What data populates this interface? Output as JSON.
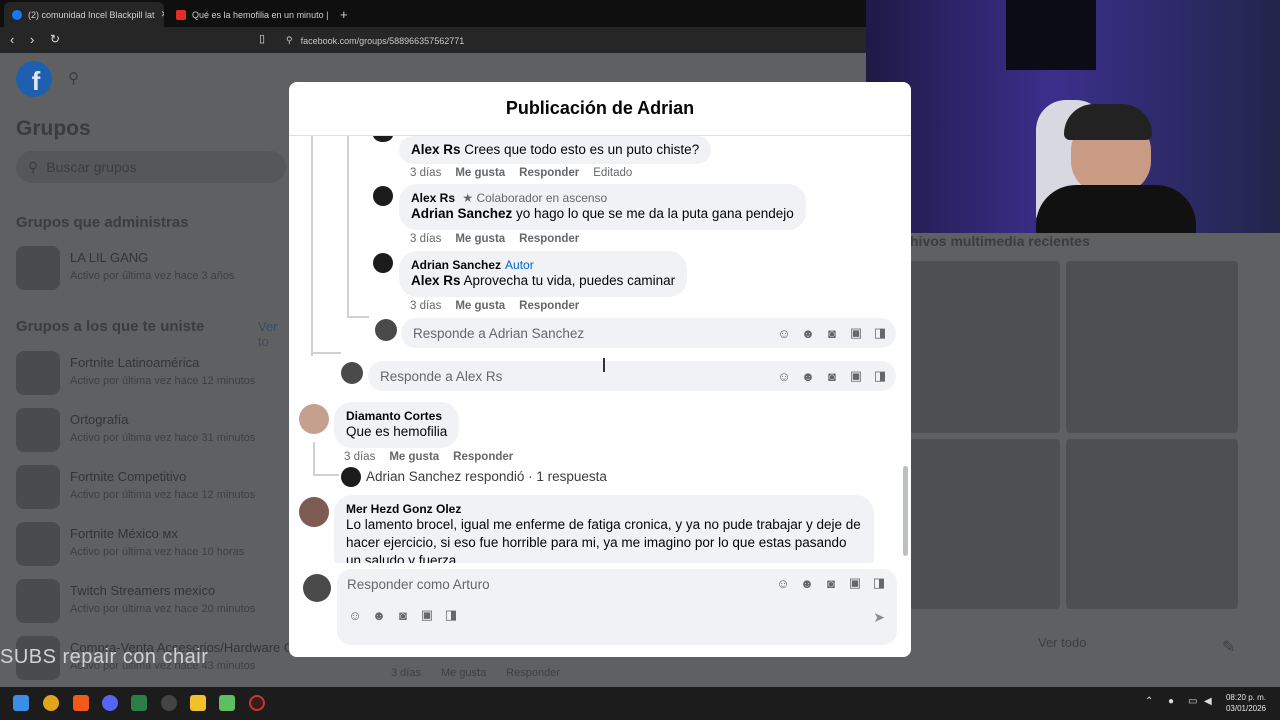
{
  "browser": {
    "tabs": [
      {
        "title": "(2) comunidad Incel Blackpill lat"
      },
      {
        "title": "Qué es la hemofilia en un minuto | Ja"
      }
    ],
    "new_tab": "+",
    "url": "facebook.com/groups/588966357562771"
  },
  "background": {
    "groups_title": "Grupos",
    "search_placeholder": "Buscar grupos",
    "admin_section": "Grupos que administras",
    "joined_section": "Grupos a los que te uniste",
    "see_all_link": "Ver to",
    "groups": [
      {
        "name": "LA LIL GANG",
        "sub": "Activo por última vez hace 3 años"
      },
      {
        "name": "Fortnite Latinoamérica",
        "sub": "Activo por última vez hace 12 minutos"
      },
      {
        "name": "Ortografía",
        "sub": "Activo por última vez hace 31 minutos"
      },
      {
        "name": "Fortnite Competitivo",
        "sub": "Activo por última vez hace 12 minutos"
      },
      {
        "name": "Fortnite México мх",
        "sub": "Activo por última vez hace 10 horas"
      },
      {
        "name": "Twitch Streamers mexico",
        "sub": "Activo por última vez hace 20 minutos"
      },
      {
        "name": "Compra-Venta Accesorios/Hardware Gamer Pc Mexico",
        "sub": "Activo por última vez hace 43 minutos"
      }
    ],
    "media_title": "hivos multimedia recientes",
    "see_all": "Ver todo"
  },
  "modal": {
    "title": "Publicación de Adrian",
    "comments": {
      "c1": {
        "name": "Alex Rs",
        "text": "Crees que todo esto es un puto chiste?",
        "time": "3 días",
        "like": "Me gusta",
        "reply": "Responder",
        "edited": "Editado"
      },
      "c2": {
        "name": "Alex Rs",
        "badge": "Colaborador en ascenso",
        "mention": "Adrian Sanchez",
        "text": "yo hago lo que se me da la puta gana pendejo",
        "time": "3 días",
        "like": "Me gusta",
        "reply": "Responder"
      },
      "c3": {
        "name": "Adrian Sanchez",
        "badge": "Autor",
        "mention": "Alex Rs",
        "text": "Aprovecha tu vida, puedes caminar",
        "time": "3 días",
        "like": "Me gusta",
        "reply": "Responder"
      },
      "c4": {
        "name": "Diamanto Cortes",
        "text": "Que es hemofilia",
        "time": "3 días",
        "like": "Me gusta",
        "reply": "Responder",
        "replies_summary": "Adrian Sanchez respondió · 1 respuesta"
      },
      "c5": {
        "name": "Mer Hezd Gonz Olez",
        "text": "Lo lamento brocel, igual me enferme de fatiga cronica, y ya no pude trabajar y deje de hacer ejercicio, si eso fue horrible para mi, ya me imagino por lo que estas pasando un saludo y fuerza"
      }
    },
    "reply_adrian_placeholder": "Responde a Adrian Sanchez",
    "reply_alex_placeholder": "Responde a Alex Rs",
    "main_reply_placeholder": "Responder como Arturo"
  },
  "overlay": {
    "subtitle": "SUBS  repair con chair",
    "ghost_meta": [
      "3 días",
      "Me gusta",
      "Responder"
    ]
  },
  "taskbar": {
    "time": "08:20 p. m.",
    "date": "03/01/2026"
  },
  "colors": {
    "fb_blue": "#0866ff",
    "author_badge": "#0064d1"
  }
}
